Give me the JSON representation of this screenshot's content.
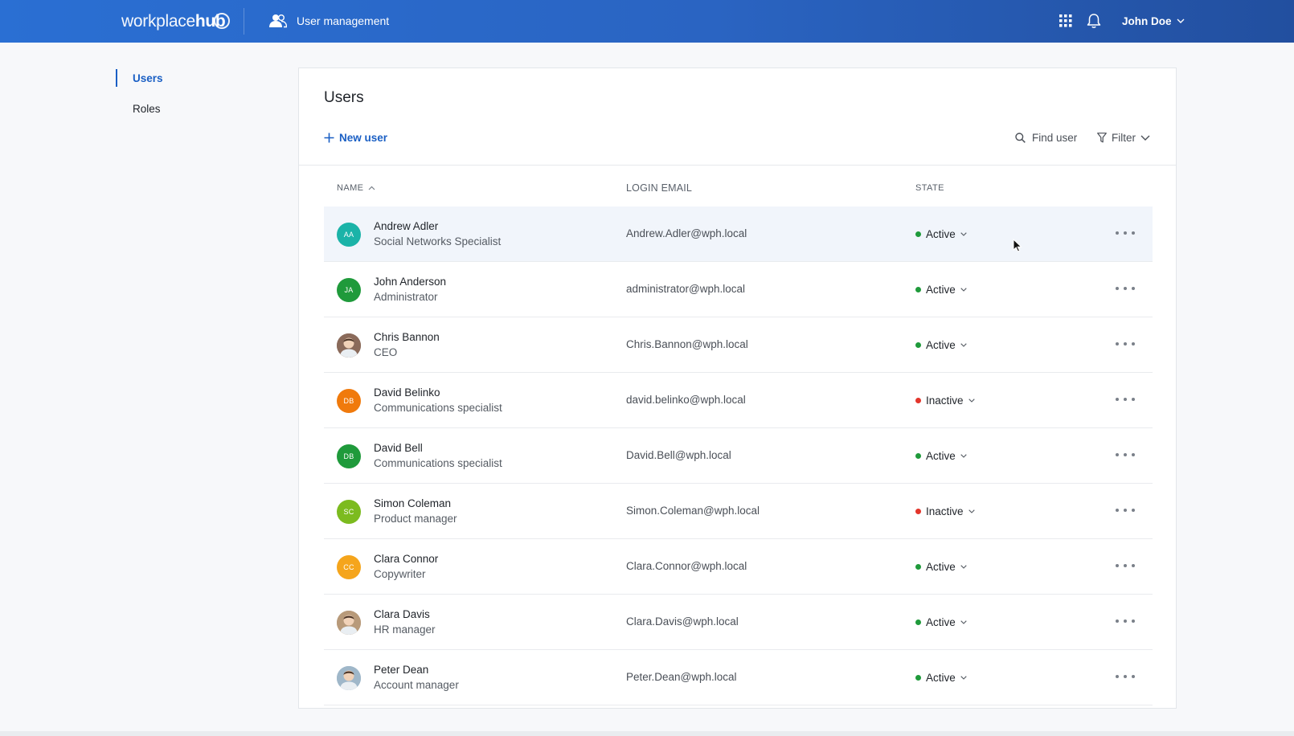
{
  "header": {
    "logo_light": "workplace",
    "logo_bold": "hub",
    "section_label": "User management",
    "user_name": "John Doe"
  },
  "sidebar": {
    "items": [
      {
        "label": "Users",
        "active": true
      },
      {
        "label": "Roles",
        "active": false
      }
    ]
  },
  "main": {
    "title": "Users",
    "new_user_label": "New user",
    "find_user_label": "Find user",
    "filter_label": "Filter",
    "columns": {
      "name": "NAME",
      "email": "LOGIN EMAIL",
      "state": "STATE"
    },
    "users": [
      {
        "name": "Andrew Adler",
        "role": "Social Networks Specialist",
        "email": "Andrew.Adler@wph.local",
        "state": "Active",
        "initials": "AA",
        "avatar_color": "#1bb3a8",
        "photo": false,
        "hover": true
      },
      {
        "name": "John Anderson",
        "role": "Administrator",
        "email": "administrator@wph.local",
        "state": "Active",
        "initials": "JA",
        "avatar_color": "#1f9a3b",
        "photo": false
      },
      {
        "name": "Chris Bannon",
        "role": "CEO",
        "email": "Chris.Bannon@wph.local",
        "state": "Active",
        "initials": "",
        "avatar_color": "#8a6a5a",
        "photo": true
      },
      {
        "name": "David Belinko",
        "role": "Communications specialist",
        "email": "david.belinko@wph.local",
        "state": "Inactive",
        "initials": "DB",
        "avatar_color": "#f07a0c",
        "photo": false
      },
      {
        "name": "David Bell",
        "role": "Communications specialist",
        "email": "David.Bell@wph.local",
        "state": "Active",
        "initials": "DB",
        "avatar_color": "#1f9a3b",
        "photo": false
      },
      {
        "name": "Simon Coleman",
        "role": "Product manager",
        "email": "Simon.Coleman@wph.local",
        "state": "Inactive",
        "initials": "SC",
        "avatar_color": "#7cbb1f",
        "photo": false
      },
      {
        "name": "Clara Connor",
        "role": "Copywriter",
        "email": "Clara.Connor@wph.local",
        "state": "Active",
        "initials": "CC",
        "avatar_color": "#f5a51c",
        "photo": false
      },
      {
        "name": "Clara Davis",
        "role": "HR manager",
        "email": "Clara.Davis@wph.local",
        "state": "Active",
        "initials": "",
        "avatar_color": "#b89a7a",
        "photo": true
      },
      {
        "name": "Peter Dean",
        "role": "Account manager",
        "email": "Peter.Dean@wph.local",
        "state": "Active",
        "initials": "",
        "avatar_color": "#9fb7c9",
        "photo": true
      }
    ]
  },
  "colors": {
    "accent": "#1a5fc4",
    "active": "#1f9a3b",
    "inactive": "#e3352b"
  },
  "icons": {
    "section": "users-icon",
    "apps": "apps-grid-icon",
    "notifications": "bell-icon",
    "user_menu": "chevron-down-icon",
    "new_user": "plus-icon",
    "find_user": "search-icon",
    "filter": "filter-icon",
    "row_actions": "more-horizontal-icon"
  }
}
